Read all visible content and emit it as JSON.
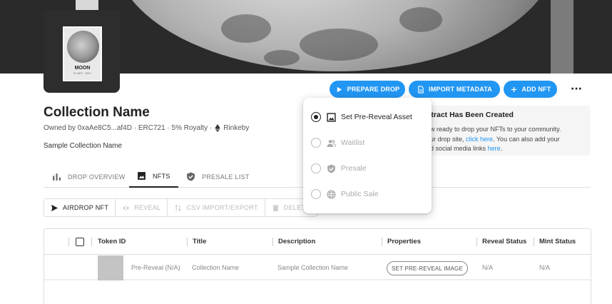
{
  "collection": {
    "avatar_title": "MOON",
    "avatar_subtitle": "PLANET · MOD",
    "name": "Collection Name",
    "owner_line": "Owned by 0xaAe8C5...af4D · ERC721 · 5% Royalty ·",
    "network": "Rinkeby",
    "description": "Sample Collection Name"
  },
  "actions": {
    "prepare_drop": "PREPARE DROP",
    "import_metadata": "IMPORT METADATA",
    "add_nft": "ADD NFT",
    "more": "···"
  },
  "info": {
    "title_visible": "ntract Has Been Created",
    "line1": "ow ready to drop your NFTs to your community.",
    "line2_prefix": "our drop site, ",
    "line2_link": "click here",
    "line2_suffix": ". You can also add your",
    "line3_prefix": "nd social media links ",
    "line3_link": "here",
    "line3_suffix": "."
  },
  "tabs": [
    {
      "label": "DROP OVERVIEW",
      "active": false
    },
    {
      "label": "NFTS",
      "active": true
    },
    {
      "label": "PRESALE LIST",
      "active": false
    }
  ],
  "toolbar": {
    "airdrop": "AIRDROP NFT",
    "reveal": "REVEAL",
    "csv": "CSV IMPORT/EXPORT",
    "delete": "DELETE"
  },
  "table": {
    "headers": [
      "Token ID",
      "Title",
      "Description",
      "Properties",
      "Reveal Status",
      "Mint Status"
    ],
    "rows": [
      {
        "token_id": "Pre-Reveal (N/A)",
        "title": "Collection Name",
        "description": "Sample Collection Name",
        "properties_button": "SET PRE-REVEAL IMAGE",
        "reveal_status": "N/A",
        "mint_status": "N/A"
      }
    ]
  },
  "menu": {
    "items": [
      {
        "label": "Set Pre-Reveal Asset",
        "selected": true,
        "enabled": true,
        "icon": "image-icon"
      },
      {
        "label": "Waitlist",
        "selected": false,
        "enabled": false,
        "icon": "people-icon"
      },
      {
        "label": "Presale",
        "selected": false,
        "enabled": false,
        "icon": "shield-check-icon"
      },
      {
        "label": "Public Sale",
        "selected": false,
        "enabled": false,
        "icon": "globe-icon"
      }
    ]
  },
  "colors": {
    "accent": "#2196f3",
    "banner": "#2a2a2a"
  }
}
